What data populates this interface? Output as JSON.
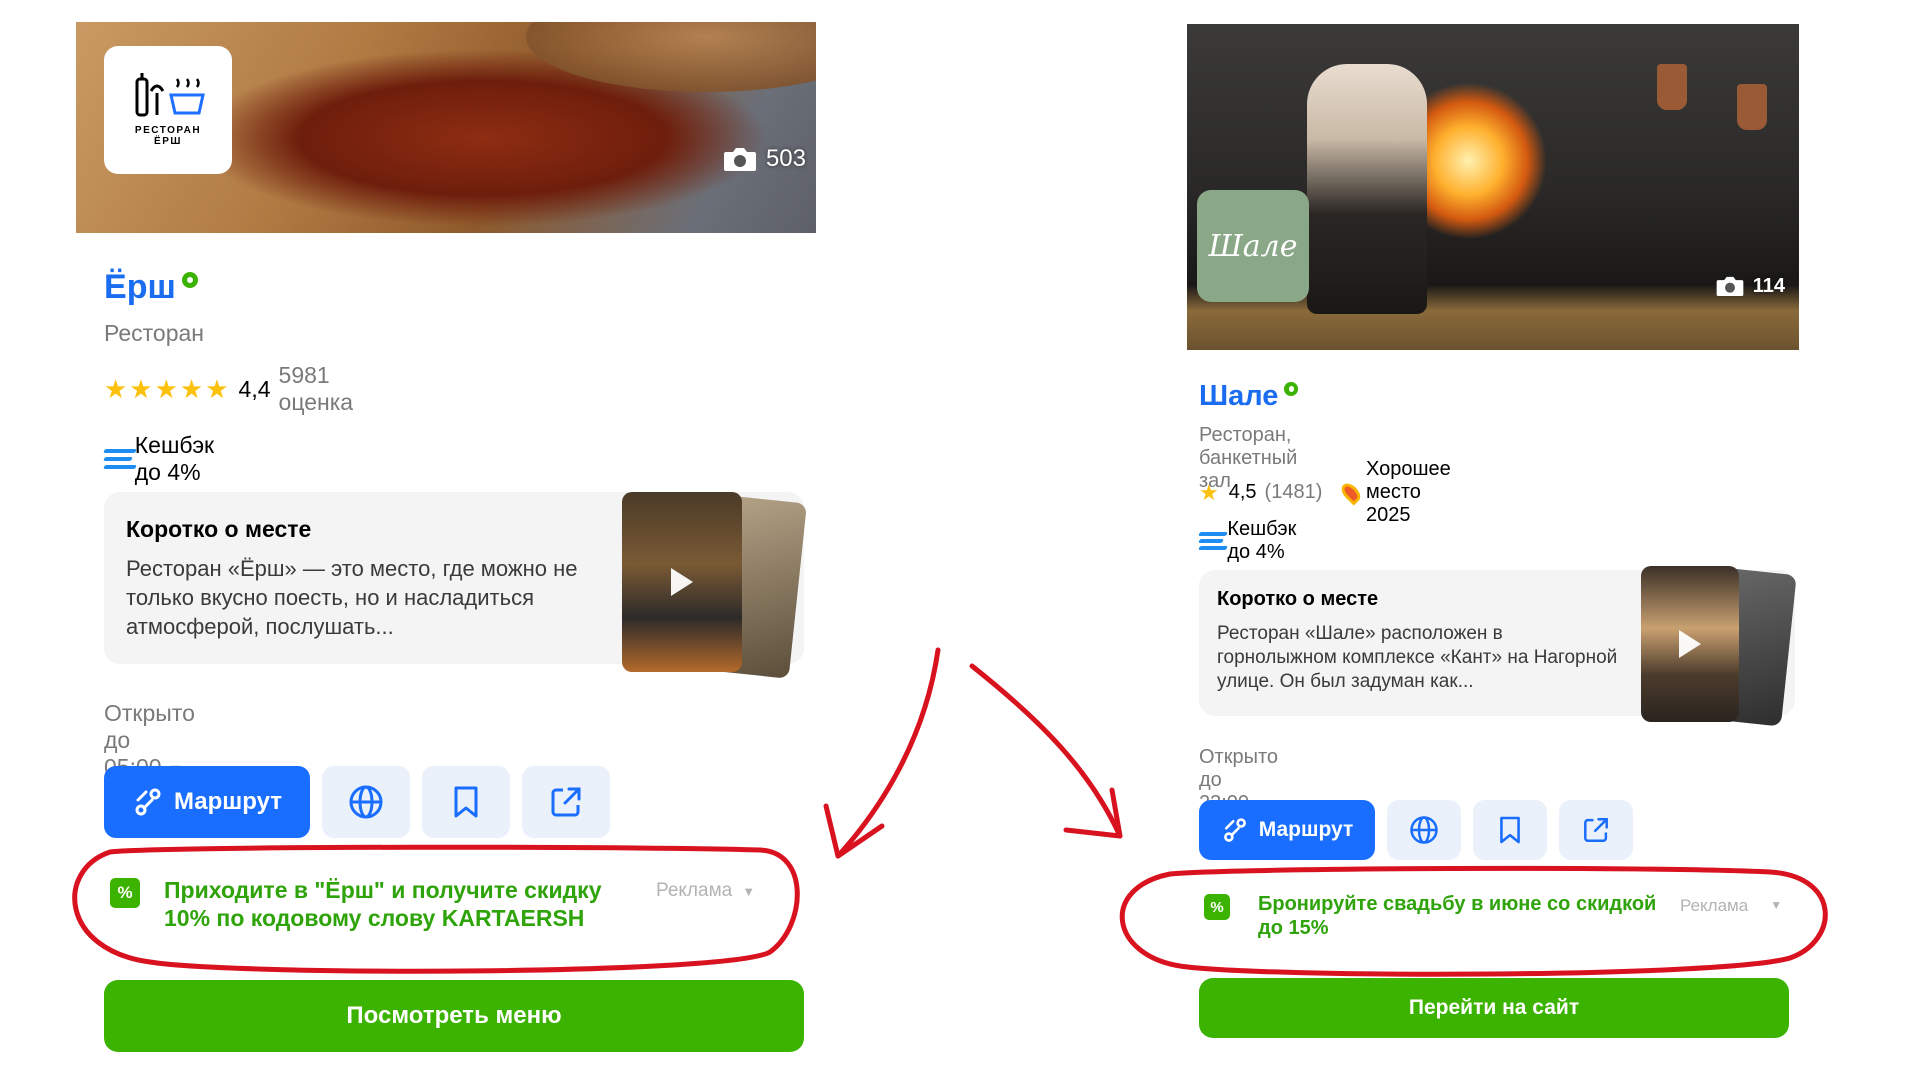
{
  "left": {
    "logo_line1": "РЕСТОРАН",
    "logo_line2": "ЁРШ",
    "photo_count": "503",
    "title": "Ёрш",
    "category": "Ресторан",
    "stars": "★★★★★",
    "rating": "4,4",
    "rating_count": "5981 оценка",
    "cashback": "Кешбэк до 4%",
    "about_title": "Коротко о месте",
    "about_text": "Ресторан «Ёрш» — это место, где можно не только вкусно поесть, но и насладиться атмосферой, послушать...",
    "hours": "Открыто до 05:00",
    "route_label": "Маршрут",
    "ad_text": "Приходите в \"Ёрш\" и получите скидку 10% по кодовому слову KARTAERSH",
    "ad_label": "Реклама",
    "cta": "Посмотреть меню"
  },
  "right": {
    "logo_text": "Шале",
    "photo_count": "114",
    "title": "Шале",
    "category": "Ресторан, банкетный зал",
    "star": "★",
    "rating": "4,5",
    "rating_count": "(1481)",
    "award": "Хорошее место 2025",
    "cashback": "Кешбэк до 4%",
    "about_title": "Коротко о месте",
    "about_text": "Ресторан «Шале» расположен в горнолыжном комплексе «Кант» на Нагорной улице. Он был задуман как...",
    "hours": "Открыто до 23:00",
    "route_label": "Маршрут",
    "ad_text": "Бронируйте свадьбу в июне со скидкой до 15%",
    "ad_label": "Реклама",
    "cta": "Перейти на сайт"
  },
  "icons": {
    "camera": "camera-icon",
    "globe": "globe-icon",
    "bookmark": "bookmark-icon",
    "share": "share-icon",
    "route": "route-icon",
    "discount": "discount-icon",
    "cashback": "cashback-icon",
    "verified": "verified-icon",
    "play": "play-icon"
  },
  "colors": {
    "link_blue": "#1a6cf0",
    "route_button": "#196dff",
    "green": "#3cb300",
    "annotation_red": "#d9121f"
  }
}
